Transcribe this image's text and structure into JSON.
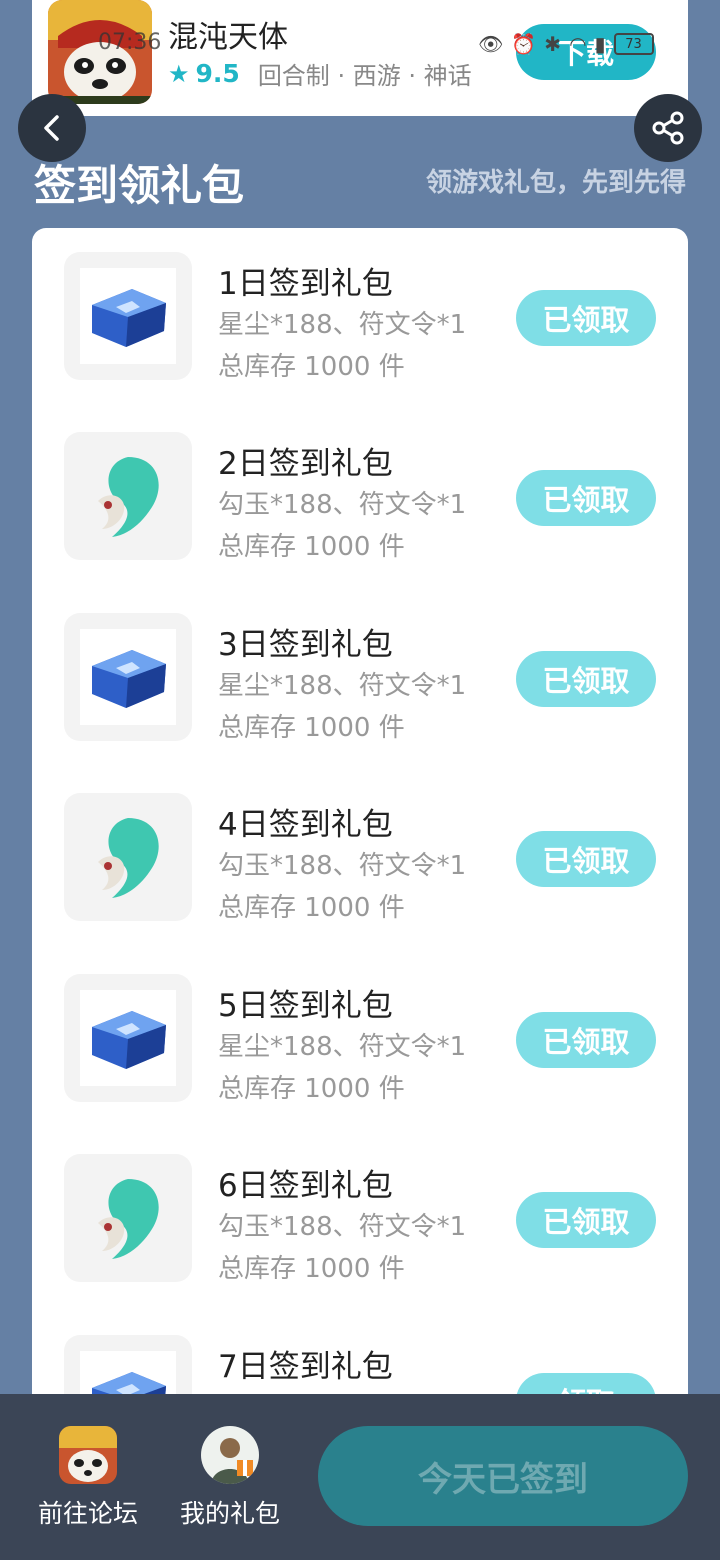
{
  "status": {
    "time": "07:36",
    "battery": "73"
  },
  "game": {
    "name": "混沌天体",
    "rating": "9.5",
    "tags": "回合制 · 西游 · 神话",
    "download_label": "下载"
  },
  "section": {
    "title": "签到领礼包",
    "subtitle": "领游戏礼包，先到先得"
  },
  "gifts": [
    {
      "title": "1日签到礼包",
      "items": "星尘*188、符文令*1",
      "stock": "总库存 1000 件",
      "icon": "star-dust-chest-icon",
      "button": "已领取"
    },
    {
      "title": "2日签到礼包",
      "items": "勾玉*188、符文令*1",
      "stock": "总库存 1000 件",
      "icon": "jade-magatama-icon",
      "button": "已领取"
    },
    {
      "title": "3日签到礼包",
      "items": "星尘*188、符文令*1",
      "stock": "总库存 1000 件",
      "icon": "star-dust-chest-icon",
      "button": "已领取"
    },
    {
      "title": "4日签到礼包",
      "items": "勾玉*188、符文令*1",
      "stock": "总库存 1000 件",
      "icon": "jade-magatama-icon",
      "button": "已领取"
    },
    {
      "title": "5日签到礼包",
      "items": "星尘*188、符文令*1",
      "stock": "总库存 1000 件",
      "icon": "star-dust-chest-icon",
      "button": "已领取"
    },
    {
      "title": "6日签到礼包",
      "items": "勾玉*188、符文令*1",
      "stock": "总库存 1000 件",
      "icon": "jade-magatama-icon",
      "button": "已领取"
    },
    {
      "title": "7日签到礼包",
      "items": "",
      "stock": "",
      "icon": "star-dust-chest-icon",
      "button": "领取"
    }
  ],
  "bottom": {
    "forum_label": "前往论坛",
    "my_gifts_label": "我的礼包",
    "signin_label": "今天已签到"
  },
  "colors": {
    "accent": "#21b6c6",
    "claimed": "#7fdee6",
    "background": "#6580a4",
    "bottom_bar": "#3b4556"
  }
}
